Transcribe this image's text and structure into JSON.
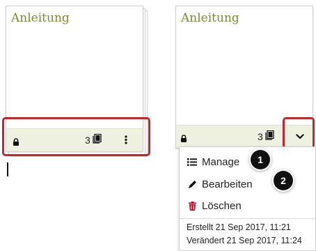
{
  "left_card": {
    "title": "Anleitung",
    "page_count": "3"
  },
  "right_card": {
    "title": "Anleitung",
    "page_count": "3"
  },
  "menu": {
    "items": [
      {
        "label": "Manage",
        "icon": "list-icon"
      },
      {
        "label": "Bearbeiten",
        "icon": "pencil-icon"
      },
      {
        "label": "Löschen",
        "icon": "trash-icon"
      }
    ],
    "created": "Erstellt 21 Sep 2017, 11:21",
    "modified": "Verändert 21 Sep 2017, 11:24"
  },
  "callouts": [
    "1",
    "2"
  ],
  "colors": {
    "title": "#7a8a3a",
    "footer": "#eef1df",
    "highlight": "#c9242b",
    "delete": "#d0021b"
  }
}
